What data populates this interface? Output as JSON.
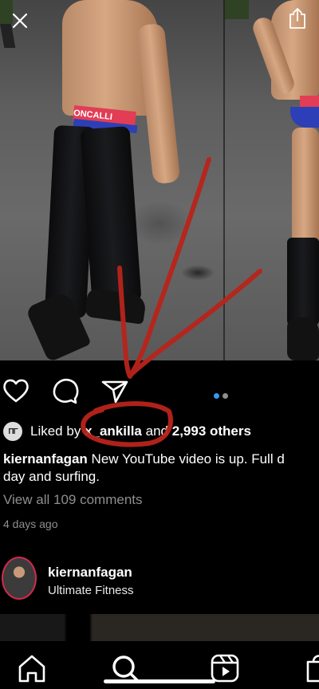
{
  "top": {
    "close_icon": "close-icon",
    "share_icon": "share-icon"
  },
  "photo": {
    "waistband_text": "ONCALLI",
    "slides_count": 2,
    "active_slide": 1
  },
  "actions": {
    "like_icon": "heart-icon",
    "comment_icon": "comment-icon",
    "share_icon": "send-icon"
  },
  "likes": {
    "prefix": "Liked by",
    "user": "x_ankilla",
    "middle": "and",
    "others": "2,993 others",
    "avatar_text": "ΠΓ"
  },
  "caption": {
    "username": "kiernanfagan",
    "line1": "New YouTube video is up. Full d",
    "line2": "day and surfing."
  },
  "comments_link": "View all 109 comments",
  "time_ago": "4 days ago",
  "suggested": {
    "username": "kiernanfagan",
    "subtitle": "Ultimate Fitness"
  },
  "nav": {
    "items": [
      "home-icon",
      "search-icon",
      "reels-icon",
      "shop-icon"
    ],
    "active": "search-icon"
  },
  "colors": {
    "background": "#000000",
    "annotation_red": "#b8241b",
    "active_dot": "#3897f0",
    "inactive_dot": "#8e8e8e",
    "secondary_text": "#8e8e8e"
  }
}
